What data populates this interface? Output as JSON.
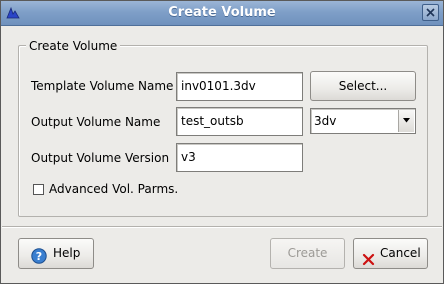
{
  "window": {
    "title": "Create Volume"
  },
  "group": {
    "title": "Create Volume"
  },
  "fields": {
    "template_label": "Template Volume Name",
    "template_value": "inv0101.3dv",
    "output_label": "Output Volume Name",
    "output_value": "test_outsb",
    "output_ext": "3dv",
    "version_label": "Output Volume Version",
    "version_value": "v3"
  },
  "buttons": {
    "select": "Select...",
    "help": "Help",
    "create": "Create",
    "cancel": "Cancel"
  },
  "advanced": {
    "label": "Advanced Vol. Parms.",
    "checked": false
  },
  "icons": {
    "app": "app-logo-icon",
    "close": "close-icon",
    "help": "help-icon",
    "cancel": "cancel-x-icon",
    "dropdown": "chevron-down-icon"
  },
  "colors": {
    "titlebar": "#7f9fc8",
    "cancel_icon": "#cc1111",
    "help_icon": "#3a7fd0"
  }
}
